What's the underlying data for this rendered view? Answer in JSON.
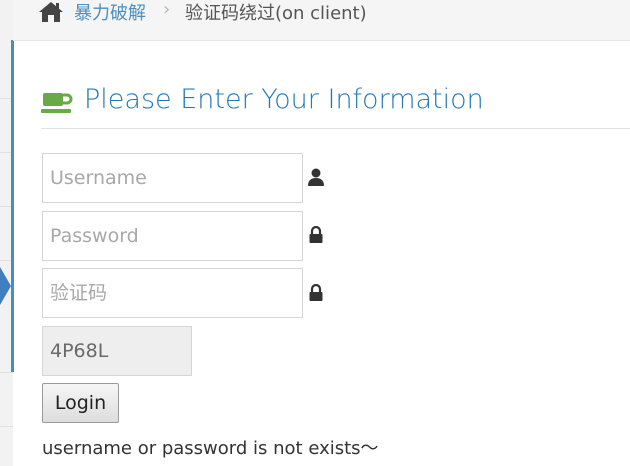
{
  "breadcrumb": {
    "home_icon": "home-icon",
    "parent": "暴力破解",
    "separator": "›",
    "current": "验证码绕过(on client)"
  },
  "header": {
    "icon": "coffee-icon",
    "title": "Please Enter Your Information"
  },
  "form": {
    "username": {
      "placeholder": "Username",
      "value": "",
      "icon": "user-icon"
    },
    "password": {
      "placeholder": "Password",
      "value": "",
      "icon": "lock-icon"
    },
    "captcha": {
      "placeholder": "验证码",
      "value": "",
      "icon": "lock-icon"
    },
    "captcha_code": "4P68L",
    "login_label": "Login"
  },
  "status": {
    "message": "username or password is not exists～"
  },
  "colors": {
    "accent": "#2679b5",
    "link": "#4c8fbd",
    "sidebar_active": "#4a8bc2",
    "icon_green": "#69aa46"
  }
}
